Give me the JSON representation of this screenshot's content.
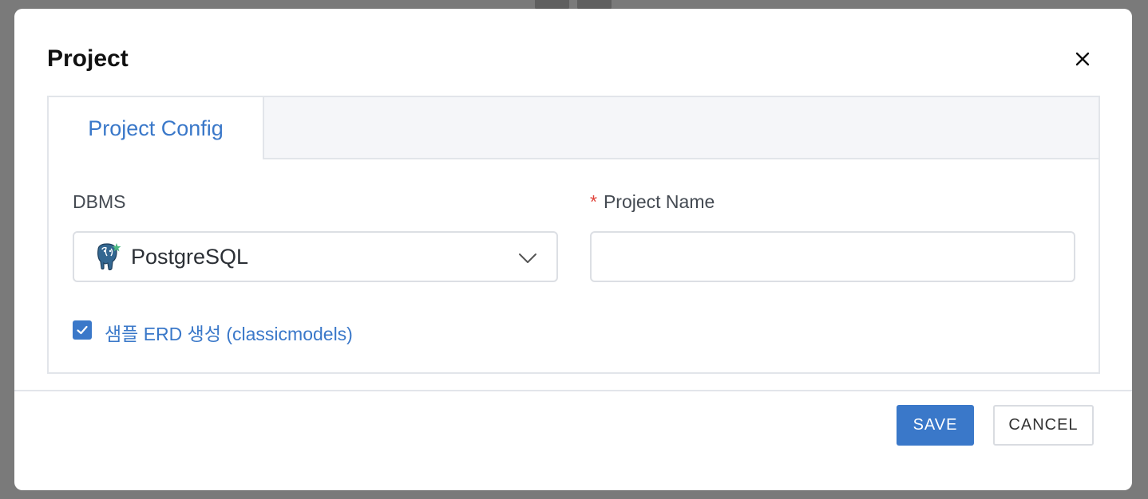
{
  "dialog": {
    "title": "Project",
    "close_icon": "close-icon"
  },
  "tabs": [
    {
      "label": "Project Config",
      "active": true
    }
  ],
  "form": {
    "dbms": {
      "label": "DBMS",
      "selected": "PostgreSQL",
      "icon": "postgresql-elephant-icon"
    },
    "project_name": {
      "required_mark": "*",
      "label": "Project Name",
      "value": "",
      "placeholder": ""
    },
    "sample_checkbox": {
      "checked": true,
      "label": "샘플 ERD 생성 (classicmodels)"
    }
  },
  "footer": {
    "save_label": "SAVE",
    "cancel_label": "CANCEL"
  },
  "colors": {
    "accent": "#3a78c9",
    "required": "#e0433a",
    "border": "#dcdfe4",
    "overlay": "#7a7a7a"
  }
}
